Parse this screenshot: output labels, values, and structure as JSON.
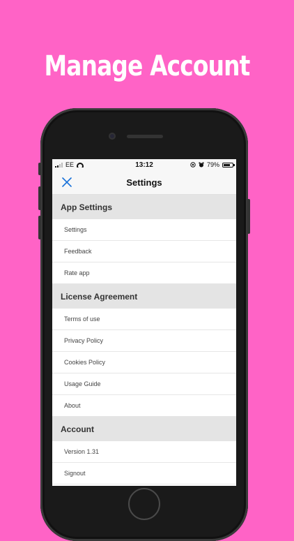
{
  "headline": "Manage Account",
  "status_bar": {
    "carrier": "EE",
    "time": "13:12",
    "battery_percent": "79%",
    "battery_level": 0.79
  },
  "nav": {
    "title": "Settings"
  },
  "sections": [
    {
      "title": "App Settings",
      "items": [
        "Settings",
        "Feedback",
        "Rate app"
      ]
    },
    {
      "title": "License Agreement",
      "items": [
        "Terms of use",
        "Privacy Policy",
        "Cookies Policy",
        "Usage Guide",
        "About"
      ]
    },
    {
      "title": "Account",
      "items": [
        "Version 1.31",
        "Signout"
      ]
    }
  ],
  "colors": {
    "background": "#ff63c6",
    "accent": "#1a73d9",
    "section_header": "#e4e4e4"
  },
  "icons": {
    "close": "close-icon",
    "wifi": "wifi-icon",
    "signal": "signal-icon",
    "battery": "battery-icon",
    "alarm": "alarm-icon",
    "location": "location-icon"
  }
}
